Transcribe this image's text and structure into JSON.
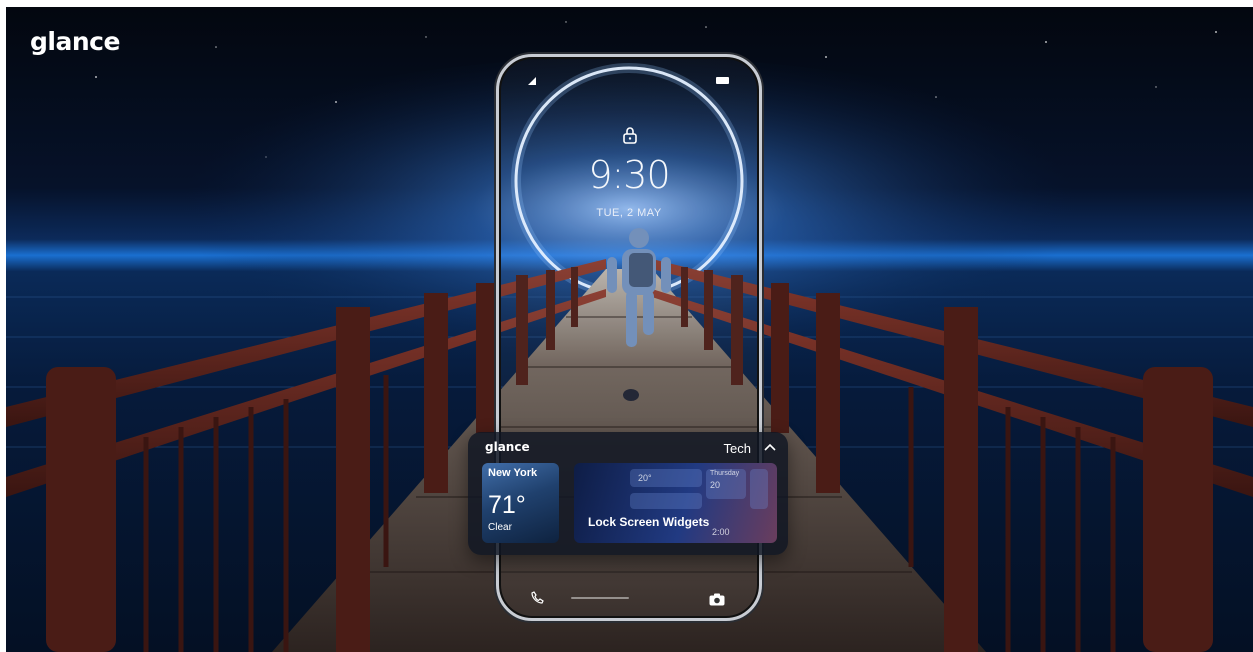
{
  "brand": {
    "logo_text": "glance"
  },
  "lockscreen": {
    "time": "9:30",
    "date": "TUE, 2 MAY",
    "icons": [
      "signal-icon",
      "battery-icon",
      "lock-icon",
      "phone-icon",
      "camera-icon"
    ]
  },
  "widget": {
    "brand_text": "glance",
    "category": "Tech",
    "weather": {
      "city": "New York",
      "temp": "71°",
      "condition": "Clear"
    },
    "promo": {
      "label": "Lock Screen Widgets",
      "mini_temp": "20°",
      "mini_weekday": "Thursday",
      "mini_day": "20",
      "mini_time": "2:00"
    }
  },
  "colors": {
    "sky": "#06122a",
    "horizon_glow": "#1a6fd0",
    "railing": "#6b2a24",
    "deck": "#4a3d36",
    "widget_bg": "#101622"
  }
}
